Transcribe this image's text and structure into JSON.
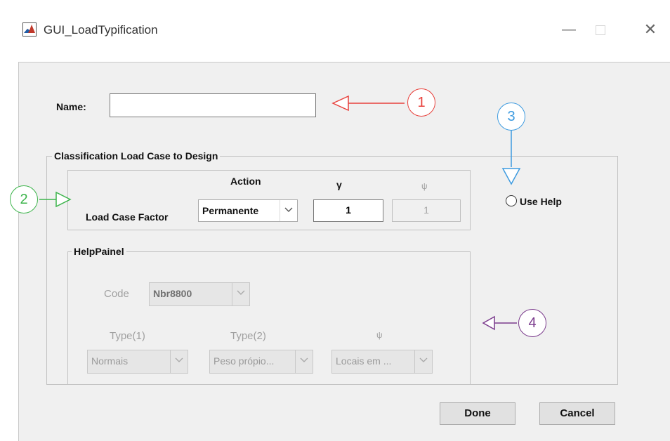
{
  "window": {
    "title": "GUI_LoadTypification",
    "minimize_glyph": "—",
    "close_glyph": "✕"
  },
  "name_field": {
    "label": "Name:",
    "value": ""
  },
  "classification": {
    "title": "Classification Load Case to Design",
    "header_action": "Action",
    "header_gamma": "γ",
    "header_psi": "ψ",
    "row_label": "Load Case Factor",
    "action_selected": "Permanente",
    "gamma_value": "1",
    "psi_value": "1"
  },
  "use_help": {
    "label": "Use Help",
    "checked": false
  },
  "help_panel": {
    "title": "HelpPainel",
    "code_label": "Code",
    "code_selected": "Nbr8800",
    "type1_label": "Type(1)",
    "type1_selected": "Normais",
    "type2_label": "Type(2)",
    "type2_selected": "Peso própio...",
    "psi_label": "ψ",
    "psi_selected": "Locais em ..."
  },
  "buttons": {
    "done": "Done",
    "cancel": "Cancel"
  },
  "annotations": [
    {
      "number": "1",
      "color": "#e8413c"
    },
    {
      "number": "2",
      "color": "#3cb44b"
    },
    {
      "number": "3",
      "color": "#3d9be0"
    },
    {
      "number": "4",
      "color": "#7a3a8c"
    }
  ],
  "icons": [
    "matlab-logo-icon",
    "minimize-icon",
    "maximize-icon",
    "close-icon",
    "chevron-down-icon",
    "radio-icon",
    "arrow-icon"
  ]
}
